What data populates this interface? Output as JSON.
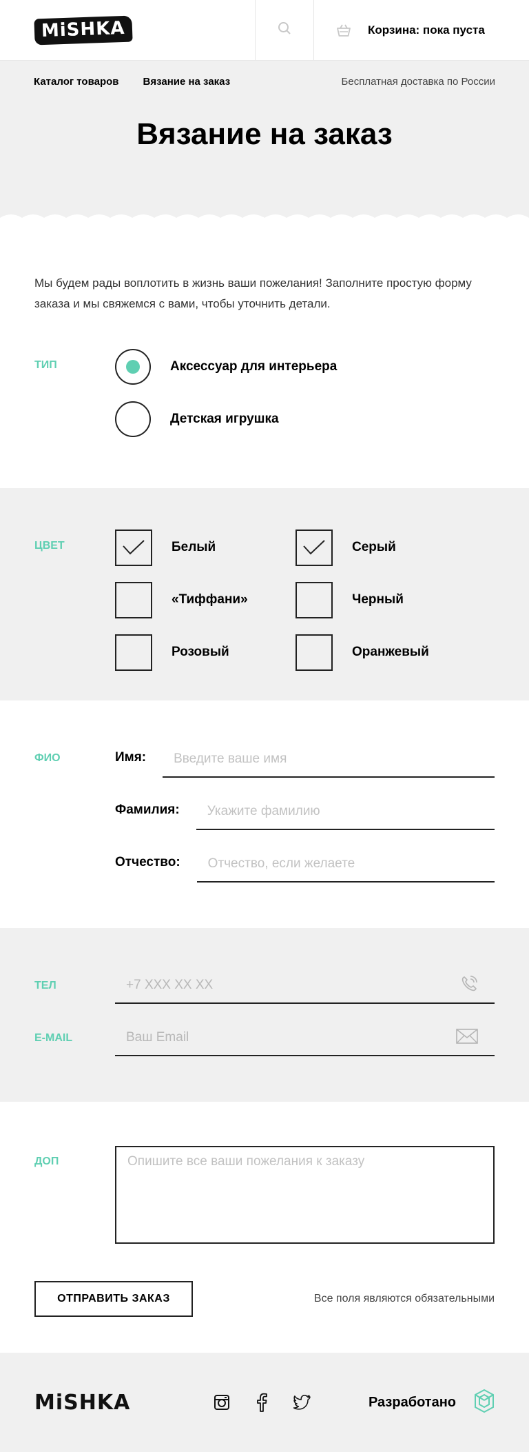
{
  "header": {
    "logo": "MiSHKA",
    "search_icon": "search-icon",
    "cart_icon": "basket-icon",
    "cart_text": "Корзина: пока пуста"
  },
  "nav": {
    "items": [
      "Каталог товаров",
      "Вязание на заказ"
    ],
    "delivery": "Бесплатная доставка по России"
  },
  "page": {
    "title": "Вязание на заказ",
    "intro": "Мы будем рады воплотить в жизнь ваши пожелания! Заполните простую форму заказа и мы свяжемся с вами, чтобы уточнить детали."
  },
  "type": {
    "label": "ТИП",
    "options": [
      {
        "label": "Аксессуар для интерьера",
        "selected": true
      },
      {
        "label": "Детская игрушка",
        "selected": false
      }
    ]
  },
  "color": {
    "label": "ЦВЕТ",
    "options": [
      {
        "label": "Белый",
        "checked": true
      },
      {
        "label": "Серый",
        "checked": true
      },
      {
        "label": "«Тиффани»",
        "checked": false
      },
      {
        "label": "Черный",
        "checked": false
      },
      {
        "label": "Розовый",
        "checked": false
      },
      {
        "label": "Оранжевый",
        "checked": false
      }
    ]
  },
  "fio": {
    "label": "ФИО",
    "first_name": {
      "label": "Имя:",
      "placeholder": "Введите ваше имя"
    },
    "last_name": {
      "label": "Фамилия:",
      "placeholder": "Укажите фамилию"
    },
    "patronymic": {
      "label": "Отчество:",
      "placeholder": "Отчество, если желаете"
    }
  },
  "contacts": {
    "phone": {
      "label": "ТЕЛ",
      "placeholder": "+7 XXX XX XX",
      "icon": "phone-icon"
    },
    "email": {
      "label": "E-MAIL",
      "placeholder": "Ваш Email",
      "icon": "envelope-icon"
    }
  },
  "extra": {
    "label": "ДОП",
    "placeholder": "Опишите все ваши пожелания к заказу"
  },
  "submit": {
    "button": "ОТПРАВИТЬ ЗАКАЗ",
    "note": "Все поля являются обязательными"
  },
  "footer": {
    "logo": "MiSHKA",
    "social": [
      "instagram-icon",
      "facebook-icon",
      "twitter-icon"
    ],
    "developed": "Разработано",
    "dev_icon": "htmlacademy-icon"
  },
  "colors": {
    "accent": "#5fcfb2",
    "band": "#f0f0f0",
    "text": "#000000"
  }
}
